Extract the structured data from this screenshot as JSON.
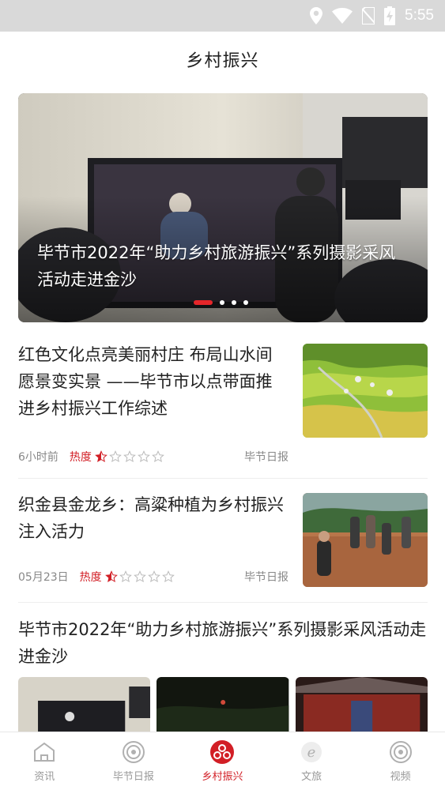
{
  "status_bar": {
    "time": "5:55"
  },
  "header": {
    "title": "乡村振兴"
  },
  "banner": {
    "title": "毕节市2022年“助力乡村旅游振兴”系列摄影采风活动走进金沙",
    "slide_count": 4,
    "active_slide": 0
  },
  "news": [
    {
      "title": "红色文化点亮美丽村庄 布局山水间 愿景变实景 ——毕节市以点带面推进乡村振兴工作综述",
      "time": "6小时前",
      "heat_label": "热度",
      "heat_stars": 0.5,
      "source": "毕节日报",
      "thumb_icon": "terraced-fields-photo"
    },
    {
      "title": "织金县金龙乡：高粱种植为乡村振兴注入活力",
      "time": "05月23日",
      "heat_label": "热度",
      "heat_stars": 0.5,
      "source": "毕节日报",
      "thumb_icon": "farmers-field-photo"
    }
  ],
  "gallery": {
    "title": "毕节市2022年“助力乡村旅游振兴”系列摄影采风活动走进金沙",
    "images": [
      "screening-room-photo",
      "night-field-photo",
      "temple-gate-photo"
    ]
  },
  "bottom_nav": [
    {
      "label": "资讯",
      "icon": "home-icon",
      "active": false
    },
    {
      "label": "毕节日报",
      "icon": "ring-icon",
      "active": false
    },
    {
      "label": "乡村振兴",
      "icon": "village-icon",
      "active": true
    },
    {
      "label": "文旅",
      "icon": "e-icon",
      "active": false
    },
    {
      "label": "视频",
      "icon": "video-ring-icon",
      "active": false
    }
  ],
  "colors": {
    "accent": "#d21f26",
    "status_bar": "#d9d9d9",
    "text": "#222222",
    "muted": "#888888"
  }
}
